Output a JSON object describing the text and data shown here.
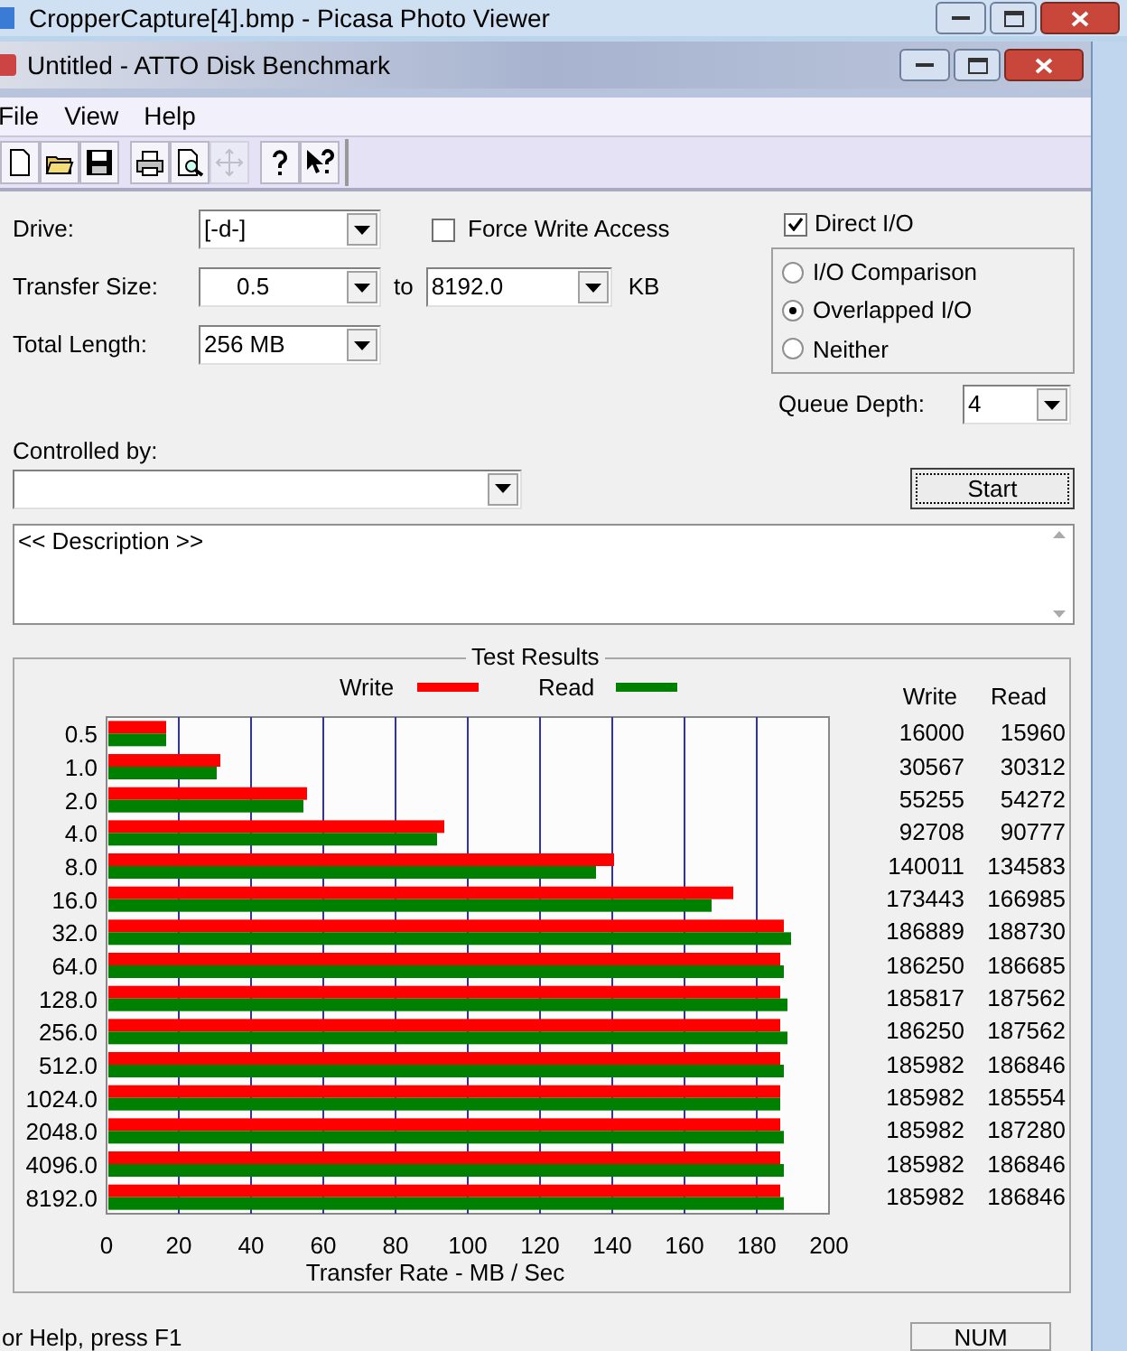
{
  "outer_window": {
    "title": "CropperCapture[4].bmp - Picasa Photo Viewer"
  },
  "window": {
    "title": "Untitled - ATTO Disk Benchmark"
  },
  "menu": [
    "File",
    "View",
    "Help"
  ],
  "toolbar": [
    {
      "kind": "new",
      "disabled": false
    },
    {
      "kind": "open",
      "disabled": false
    },
    {
      "kind": "save",
      "disabled": false
    },
    {
      "kind": "print",
      "disabled": false
    },
    {
      "kind": "preview",
      "disabled": false
    },
    {
      "kind": "move",
      "disabled": true
    },
    {
      "kind": "help",
      "disabled": false
    },
    {
      "kind": "context-help",
      "disabled": false
    }
  ],
  "form": {
    "drive": {
      "label": "Drive:",
      "value": "[-d-]"
    },
    "force_write_access": {
      "label": "Force Write Access",
      "checked": false
    },
    "direct_io": {
      "label": "Direct I/O",
      "checked": true
    },
    "transfer_size": {
      "label": "Transfer Size:",
      "from": "0.5",
      "to_label": "to",
      "to": "8192.0",
      "unit": "KB"
    },
    "total_length": {
      "label": "Total Length:",
      "value": "256 MB"
    },
    "io_modes": [
      {
        "label": "I/O Comparison",
        "selected": false
      },
      {
        "label": "Overlapped I/O",
        "selected": true
      },
      {
        "label": "Neither",
        "selected": false
      }
    ],
    "queue_depth": {
      "label": "Queue Depth:",
      "value": "4"
    },
    "controlled_by": {
      "label": "Controlled by:"
    },
    "start_button": "Start",
    "description": "<< Description >>"
  },
  "results": {
    "chart_data": {
      "type": "bar",
      "orientation": "horizontal",
      "title": "Test Results",
      "xlabel": "Transfer Rate - MB / Sec",
      "categories": [
        "0.5",
        "1.0",
        "2.0",
        "4.0",
        "8.0",
        "16.0",
        "32.0",
        "64.0",
        "128.0",
        "256.0",
        "512.0",
        "1024.0",
        "2048.0",
        "4096.0",
        "8192.0"
      ],
      "series": [
        {
          "name": "Write",
          "color": "#ff0000",
          "values": [
            16,
            31,
            55,
            93,
            140,
            173,
            187,
            186,
            186,
            186,
            186,
            186,
            186,
            186,
            186
          ]
        },
        {
          "name": "Read",
          "color": "#008000",
          "values": [
            16,
            30,
            54,
            91,
            135,
            167,
            189,
            187,
            188,
            188,
            187,
            186,
            187,
            187,
            187
          ]
        }
      ],
      "xlim": [
        0,
        200
      ],
      "xticks": [
        0,
        20,
        40,
        60,
        80,
        100,
        120,
        140,
        160,
        180,
        200
      ],
      "grid": true,
      "legend": true
    },
    "columns": [
      "Write",
      "Read"
    ],
    "rows": [
      [
        "16000",
        "15960"
      ],
      [
        "30567",
        "30312"
      ],
      [
        "55255",
        "54272"
      ],
      [
        "92708",
        "90777"
      ],
      [
        "140011",
        "134583"
      ],
      [
        "173443",
        "166985"
      ],
      [
        "186889",
        "188730"
      ],
      [
        "186250",
        "186685"
      ],
      [
        "185817",
        "187562"
      ],
      [
        "186250",
        "187562"
      ],
      [
        "185982",
        "186846"
      ],
      [
        "185982",
        "185554"
      ],
      [
        "185982",
        "187280"
      ],
      [
        "185982",
        "186846"
      ],
      [
        "185982",
        "186846"
      ]
    ]
  },
  "status_bar": {
    "text": "or Help, press F1",
    "indicator": "NUM"
  }
}
